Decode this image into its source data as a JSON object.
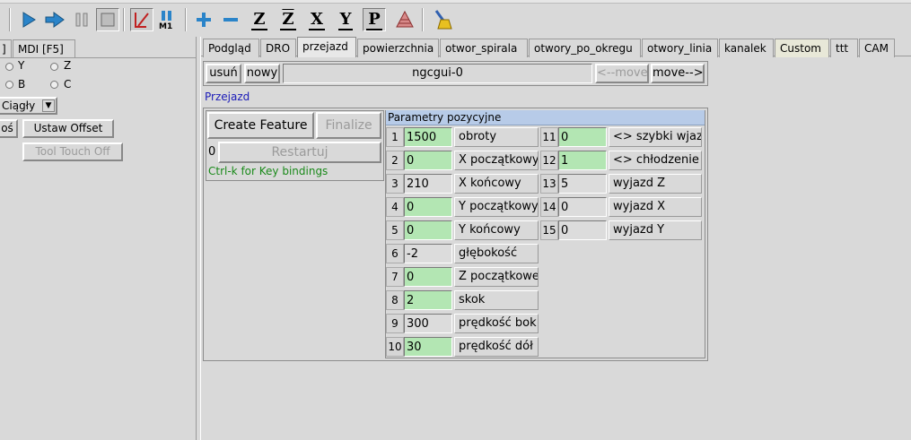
{
  "toolbar": {
    "icons": [
      "run-icon",
      "step-icon",
      "pause-icon",
      "stop-icon",
      "block-delete-icon",
      "optional-stop-icon",
      "zoom-in-icon",
      "zoom-out-icon",
      "view-z-icon",
      "view-z2-icon",
      "view-x-icon",
      "view-y-icon",
      "view-p-icon",
      "rotate-icon",
      "clear-plot-icon"
    ],
    "view_z": "Z",
    "view_z2": "Z",
    "view_x": "X",
    "view_y": "Y",
    "view_p": "P",
    "m1": "M1"
  },
  "left": {
    "tab_partial": "]",
    "tab_mdi": "MDI [F5]",
    "axis_y": "Y",
    "axis_z": "Z",
    "axis_b": "B",
    "axis_c": "C",
    "jog_mode": "Ciągły",
    "btn_partial": "oś",
    "ustaw_offset": "Ustaw Offset",
    "tool_touch_off": "Tool Touch Off"
  },
  "tabs": [
    "Podgląd",
    "DRO",
    "przejazd",
    "powierzchnia",
    "otwor_spirala",
    "otwory_po_okregu",
    "otwory_linia",
    "kanalek",
    "Custom",
    "ttt",
    "CAM"
  ],
  "ngcgui": {
    "usun": "usuń",
    "nowy": "nowy",
    "filename": "ngcgui-0",
    "move_left": "<--move",
    "move_right": "move-->",
    "section_title": "Przejazd",
    "create_feature": "Create Feature",
    "finalize": "Finalize",
    "restart_count": "0",
    "restartuj": "Restartuj",
    "key_bindings": "Ctrl-k for Key bindings",
    "params_title": "Parametry pozycyjne"
  },
  "params": [
    {
      "n": "1",
      "value": "1500",
      "label": "obroty",
      "color": "green"
    },
    {
      "n": "2",
      "value": "0",
      "label": "X początkowy",
      "color": "green"
    },
    {
      "n": "3",
      "value": "210",
      "label": "X końcowy",
      "color": "gray"
    },
    {
      "n": "4",
      "value": "0",
      "label": "Y początkowy",
      "color": "green"
    },
    {
      "n": "5",
      "value": "0",
      "label": "Y końcowy",
      "color": "green"
    },
    {
      "n": "6",
      "value": "-2",
      "label": "głębokość",
      "color": "gray"
    },
    {
      "n": "7",
      "value": "0",
      "label": "Z początkowe",
      "color": "green"
    },
    {
      "n": "8",
      "value": "2",
      "label": "skok",
      "color": "green"
    },
    {
      "n": "9",
      "value": "300",
      "label": "prędkość bok",
      "color": "gray"
    },
    {
      "n": "10",
      "value": "30",
      "label": "prędkość dół",
      "color": "green"
    }
  ],
  "params_right": [
    {
      "n": "11",
      "value": "0",
      "label": "<> szybki wjazd",
      "color": "green"
    },
    {
      "n": "12",
      "value": "1",
      "label": "<> chłodzenie",
      "color": "green"
    },
    {
      "n": "13",
      "value": "5",
      "label": "wyjazd Z",
      "color": "gray"
    },
    {
      "n": "14",
      "value": "0",
      "label": "wyjazd X",
      "color": "gray"
    },
    {
      "n": "15",
      "value": "0",
      "label": "wyjazd Y",
      "color": "gray"
    }
  ]
}
